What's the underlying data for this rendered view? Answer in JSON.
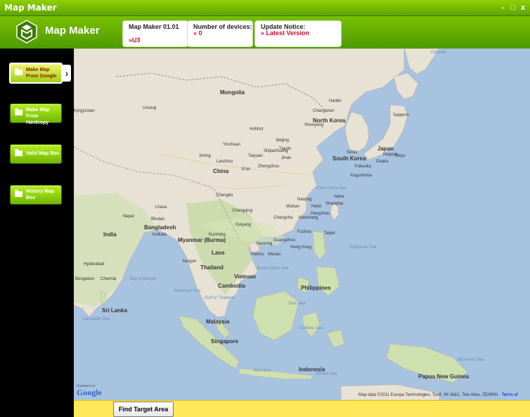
{
  "window": {
    "title": "Map Maker",
    "controls": {
      "minimize": "-",
      "maximize": "□",
      "close": "x"
    }
  },
  "header": {
    "app_name": "Map Maker",
    "info": [
      {
        "label": "Map Maker 01.01",
        "value": "»U3"
      },
      {
        "label": "Number of devices:",
        "value": "» 0"
      },
      {
        "label": "Update Notice:",
        "value": "» Latest Version"
      }
    ]
  },
  "sidebar": {
    "items": [
      {
        "label": "Make Map From Google",
        "active": true
      },
      {
        "label": "Make Map From Hardcopy",
        "active": false
      },
      {
        "label": "Valid Map Box",
        "active": false
      },
      {
        "label": "History Map Box",
        "active": false
      }
    ],
    "arrow": "›"
  },
  "map": {
    "labels": {
      "mongolia": "Mongolia",
      "china": "China",
      "india": "India",
      "beijing": "Beijing",
      "shanghai": "Shanghai",
      "harbin": "Harbin",
      "changchun": "Changchun",
      "shenyang": "Shenyang",
      "hohhot": "Hohhot",
      "tianjin": "Tianjin",
      "urumqi": "Urumqi",
      "xining": "Xining",
      "lanzhou": "Lanzhou",
      "yinchuan": "Yinchuan",
      "taiyuan": "Taiyuan",
      "shijiazhuang": "Shijiazhuang",
      "jinan": "Jinan",
      "xian": "Xi'an",
      "zhengzhou": "Zhengzhou",
      "nanjing": "Nanjing",
      "wuhan": "Wuhan",
      "hefei": "Hefei",
      "hangzhou": "Hangzhou",
      "chengdu": "Chengdu",
      "chongqing": "Chongqing",
      "changsha": "Changsha",
      "nanchang": "Nanchang",
      "fuzhou": "Fuzhou",
      "taipei": "Taipei",
      "guiyang": "Guiyang",
      "kunming": "Kunming",
      "nanning": "Nanning",
      "guangzhou": "Guangzhou",
      "hongkong": "Hong Kong",
      "macau": "Macau",
      "haikou": "Haikou",
      "lhasa": "Lhasa",
      "nepal": "Nepal",
      "bhutan": "Bhutan",
      "bangladesh": "Bangladesh",
      "myanmar": "Myanmar (Burma)",
      "laos": "Laos",
      "thailand": "Thailand",
      "vietnam": "Vietnam",
      "cambodia": "Cambodia",
      "malaysia": "Malaysia",
      "singapore": "Singapore",
      "indonesia": "Indonesia",
      "philippines": "Philippines",
      "sri_lanka": "Sri Lanka",
      "north_korea": "North Korea",
      "south_korea": "South Korea",
      "seoul": "Seoul",
      "japan": "Japan",
      "tokyo": "Tokyo",
      "sapporo": "Sapporo",
      "osaka": "Osaka",
      "nagoya": "Nagoya",
      "fukuoka": "Fukuoka",
      "kagoshima": "Kagoshima",
      "naha": "Naha",
      "kolkata": "Kolkata",
      "hyderabad": "Hyderabad",
      "chennai": "Chennai",
      "bengaluru": "Bengaluru",
      "yangon": "Yangon",
      "kyrgyzstan": "Kyrgyzstan",
      "papua": "Papua New Guinea",
      "east_china_sea": "East China Sea",
      "south_china_sea": "South China Sea",
      "philippine_sea": "Philippine Sea",
      "bay_of_bengal": "Bay of Bengal",
      "andaman_sea": "Andaman Sea",
      "gulf_thailand": "Gulf of Thailand",
      "java_sea": "Java Sea",
      "banda_sea": "Banda Sea",
      "laccadive_sea": "Laccadive Sea",
      "bismarck_sea": "Bismarck Sea",
      "celebes_sea": "Celebes Sea",
      "sulu_sea": "Sulu Sea",
      "okhotsk": "Okhotsk"
    },
    "powered_by": "POWERED BY",
    "google": "Google",
    "credit": "Map data ©2011 Europa Technologies, Tyolf, SK M&C, Tele Atlas, ZENRIN - ",
    "terms": "Terms of"
  },
  "bottom": {
    "find_button": "Find Target Area"
  }
}
